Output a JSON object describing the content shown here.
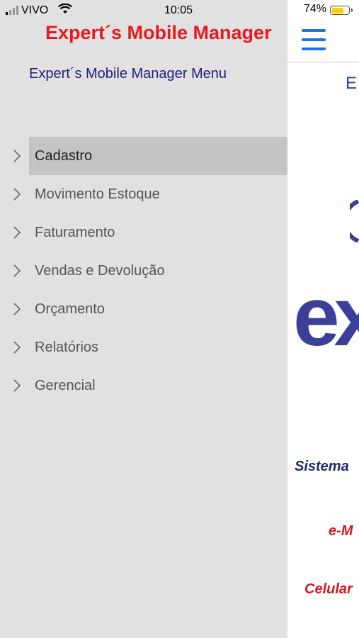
{
  "status_bar": {
    "carrier": "VIVO",
    "time": "10:05",
    "battery_percent": "74%",
    "battery_level": 0.74,
    "battery_color": "#ffcc00"
  },
  "drawer": {
    "app_title": "Expert´s Mobile Manager",
    "menu_title": "Expert´s Mobile Manager Menu",
    "items": [
      {
        "label": "Cadastro",
        "selected": true
      },
      {
        "label": "Movimento Estoque"
      },
      {
        "label": "Faturamento"
      },
      {
        "label": "Vendas e Devolução"
      },
      {
        "label": "Orçamento"
      },
      {
        "label": "Relatórios"
      },
      {
        "label": "Gerencial"
      }
    ]
  },
  "main": {
    "heading_partial": "E",
    "logo_text": "ex",
    "sistema_partial": "Sistema",
    "email_partial": "e-M",
    "celular_partial": "Celular"
  },
  "colors": {
    "accent": "#1a73e8",
    "title_red": "#e8191e",
    "navy": "#1e1e7a",
    "logo_blue": "#3c3f9a"
  }
}
